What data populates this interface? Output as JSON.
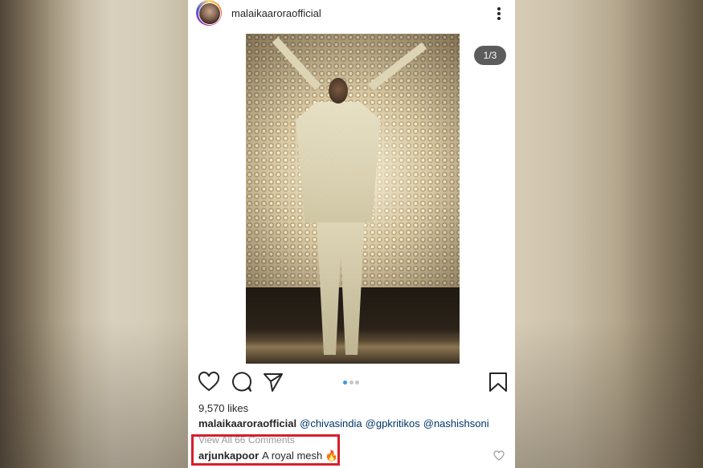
{
  "post": {
    "username": "malaikaaroraofficial",
    "carousel_counter": "1/3",
    "likes": "9,570 likes",
    "caption": {
      "user": "malaikaaroraofficial",
      "tags": [
        "@chivasindia",
        "@gpkritikos",
        "@nashishsoni"
      ]
    },
    "view_comments": "View All 66 Comments",
    "comment": {
      "user": "arjunkapoor",
      "text": "A royal mesh 🔥"
    }
  },
  "icons": {
    "more": "more-options-icon",
    "like": "heart-icon",
    "comment": "comment-icon",
    "share": "share-icon",
    "save": "bookmark-icon",
    "comment_like": "small-heart-icon"
  },
  "colors": {
    "highlight_border": "#d71f2a",
    "carousel_active_dot": "#3897f0",
    "tag_link": "#003569"
  }
}
